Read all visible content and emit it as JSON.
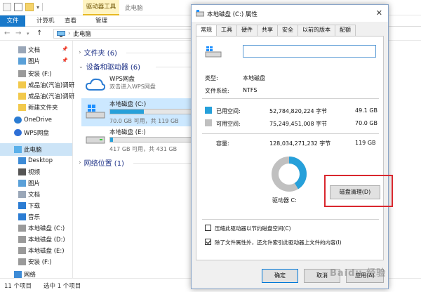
{
  "explorer": {
    "window_title": "此电脑",
    "context_group": "驱动器工具",
    "ribbon_tabs": [
      "文件",
      "计算机",
      "查看",
      "管理"
    ],
    "address_path": "此电脑"
  },
  "sidebar": {
    "items": [
      {
        "label": "文档",
        "icon": "document-icon",
        "pinned": true
      },
      {
        "label": "图片",
        "icon": "picture-icon",
        "pinned": true
      },
      {
        "label": "安装 (F:)",
        "icon": "drive-icon"
      },
      {
        "label": "成品油(汽油)调研",
        "icon": "folder-icon"
      },
      {
        "label": "成品油(汽油)调研",
        "icon": "folder-icon"
      },
      {
        "label": "新建文件夹",
        "icon": "folder-icon"
      },
      {
        "label": "OneDrive",
        "icon": "cloud-icon"
      },
      {
        "label": "WPS网盘",
        "icon": "wps-cloud-icon"
      },
      {
        "label": "此电脑",
        "icon": "computer-icon",
        "selected": true
      },
      {
        "label": "Desktop",
        "icon": "desktop-icon"
      },
      {
        "label": "视频",
        "icon": "video-icon"
      },
      {
        "label": "图片",
        "icon": "picture-icon"
      },
      {
        "label": "文档",
        "icon": "document-icon"
      },
      {
        "label": "下载",
        "icon": "download-icon"
      },
      {
        "label": "音乐",
        "icon": "music-icon"
      },
      {
        "label": "本地磁盘 (C:)",
        "icon": "drive-icon"
      },
      {
        "label": "本地磁盘 (D:)",
        "icon": "drive-icon"
      },
      {
        "label": "本地磁盘 (E:)",
        "icon": "drive-icon"
      },
      {
        "label": "安装 (F:)",
        "icon": "drive-icon"
      },
      {
        "label": "网络",
        "icon": "network-icon"
      }
    ]
  },
  "content": {
    "folders_group": "文件夹 (6)",
    "devices_group": "设备和驱动器 (6)",
    "network_group": "网络位置 (1)",
    "wps": {
      "name": "WPS网盘",
      "subtitle": "双击进入WPS网盘"
    },
    "drives": [
      {
        "name": "本地磁盘 (C:)",
        "free": "70.0 GB 可用，共 119 GB",
        "used_fraction": 0.41
      },
      {
        "name": "本地磁盘 (E:)",
        "free": "417 GB 可用，共 431 GB",
        "used_fraction": 0.03
      }
    ]
  },
  "status": {
    "item_count": "11 个项目",
    "selected": "选中 1 个项目"
  },
  "dialog": {
    "title": "本地磁盘 (C:) 属性",
    "tabs": [
      "常规",
      "工具",
      "硬件",
      "共享",
      "安全",
      "以前的版本",
      "配额"
    ],
    "active_tab": 0,
    "name_value": "",
    "type_label": "类型:",
    "type_value": "本地磁盘",
    "fs_label": "文件系统:",
    "fs_value": "NTFS",
    "used_label": "已用空间:",
    "used_bytes": "52,784,820,224 字节",
    "used_size": "49.1 GB",
    "free_label": "可用空间:",
    "free_bytes": "75,249,451,008 字节",
    "free_size": "70.0 GB",
    "capacity_label": "容量:",
    "capacity_bytes": "128,034,271,232 字节",
    "capacity_size": "119 GB",
    "drive_label": "驱动器 C:",
    "cleanup_button": "磁盘清理(D)",
    "compress_label": "压缩此驱动器以节约磁盘空间(C)",
    "index_label": "除了文件属性外，还允许索引此驱动器上文件的内容(I)",
    "compress_checked": false,
    "index_checked": true,
    "ok": "确定",
    "cancel": "取消",
    "apply": "应用(A)",
    "used_fraction": 0.412,
    "colors": {
      "used": "#26a0da",
      "free": "#c0c0c0"
    }
  },
  "watermark": "Baidu 经验"
}
